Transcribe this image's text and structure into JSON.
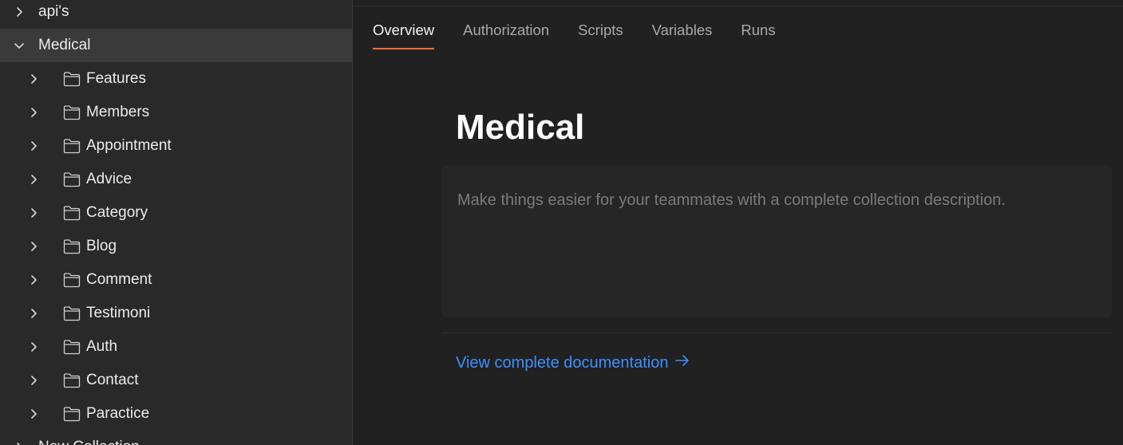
{
  "sidebar": {
    "top_item": {
      "label": "api's",
      "expanded": false
    },
    "selected_collection": {
      "label": "Medical",
      "expanded": true
    },
    "folders": [
      {
        "label": "Features"
      },
      {
        "label": "Members"
      },
      {
        "label": "Appointment"
      },
      {
        "label": "Advice"
      },
      {
        "label": "Category"
      },
      {
        "label": "Blog"
      },
      {
        "label": "Comment"
      },
      {
        "label": "Testimoni"
      },
      {
        "label": "Auth"
      },
      {
        "label": "Contact"
      },
      {
        "label": "Paractice"
      }
    ],
    "next_item": {
      "label": "New Collection",
      "expanded": false
    }
  },
  "tabs": [
    {
      "label": "Overview",
      "active": true
    },
    {
      "label": "Authorization",
      "active": false
    },
    {
      "label": "Scripts",
      "active": false
    },
    {
      "label": "Variables",
      "active": false
    },
    {
      "label": "Runs",
      "active": false
    }
  ],
  "collection": {
    "title": "Medical",
    "description_placeholder": "Make things easier for your teammates with a complete collection description.",
    "docs_link_label": "View complete documentation"
  },
  "colors": {
    "accent_tab_underline": "#ff6c37",
    "link": "#3b8fff",
    "sidebar_bg": "#292929",
    "main_bg": "#212121"
  },
  "icons": {
    "collapsed": "chevron-right-icon",
    "expanded": "chevron-down-icon",
    "folder": "folder-icon",
    "link_arrow": "arrow-right-icon"
  }
}
